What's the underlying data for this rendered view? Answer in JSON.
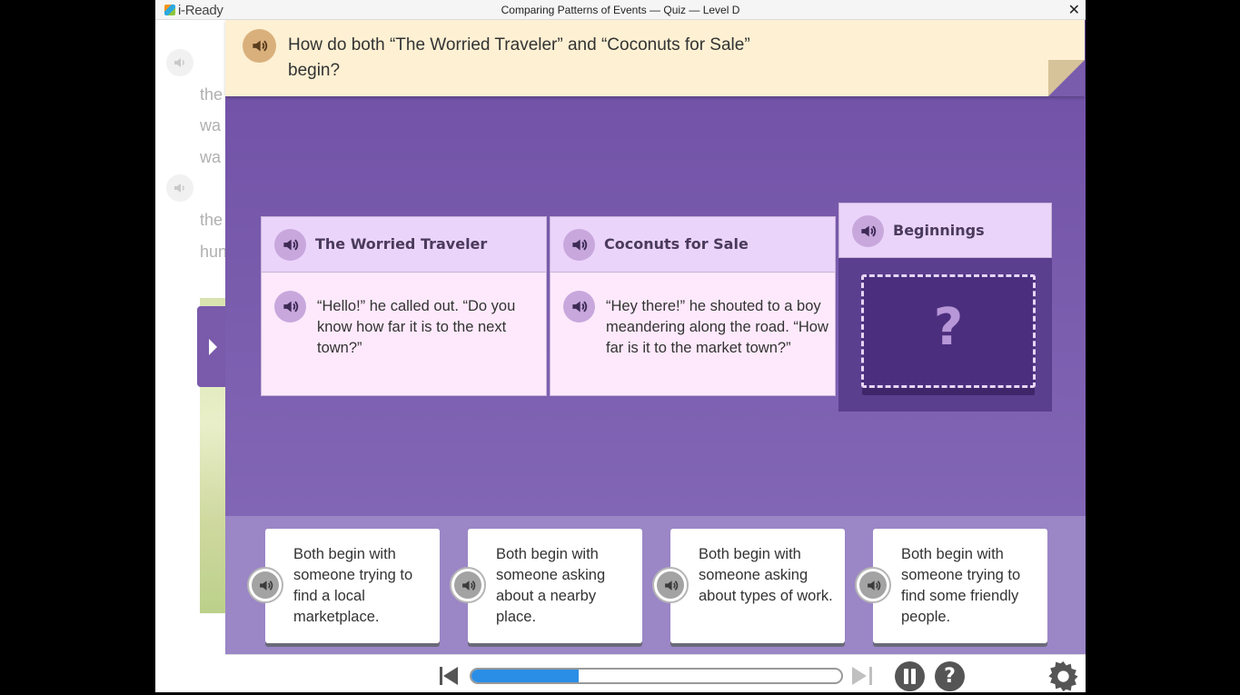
{
  "titlebar": {
    "logo_text": "i-Ready",
    "window_title": "Comparing Patterns of Events — Quiz — Level D",
    "close_glyph": "✕"
  },
  "passage": {
    "lines": [
      "the",
      "wa",
      "wa",
      "the",
      "hun"
    ]
  },
  "question": {
    "text": "How do both “The Worried Traveler” and “Coconuts for Sale” begin?"
  },
  "columns": [
    {
      "title": "The Worried Traveler",
      "quote": "“Hello!” he called out. “Do you know how far it is to the next town?”"
    },
    {
      "title": "Coconuts for Sale",
      "quote": "“Hey there!” he shouted to a boy meandering along the road. “How far is it to the market town?”"
    }
  ],
  "target": {
    "title": "Beginnings",
    "placeholder": "?"
  },
  "answers": [
    {
      "text": "Both begin with someone trying to find a local marketplace."
    },
    {
      "text": "Both begin with someone asking about a nearby place."
    },
    {
      "text": "Both begin with someone asking about types of work."
    },
    {
      "text": "Both begin with someone trying to find some friendly people."
    }
  ],
  "controls": {
    "progress_fraction": 0.29,
    "help_glyph": "?"
  },
  "colors": {
    "accent_purple": "#7a5cad",
    "progress_blue": "#2a8ee6",
    "banner": "#fdf0d3"
  },
  "icons": {
    "audio": "speaker-icon",
    "settings": "gear-icon",
    "pause": "pause-icon",
    "help": "help-icon",
    "back": "skip-back-icon",
    "forward": "skip-forward-icon"
  }
}
